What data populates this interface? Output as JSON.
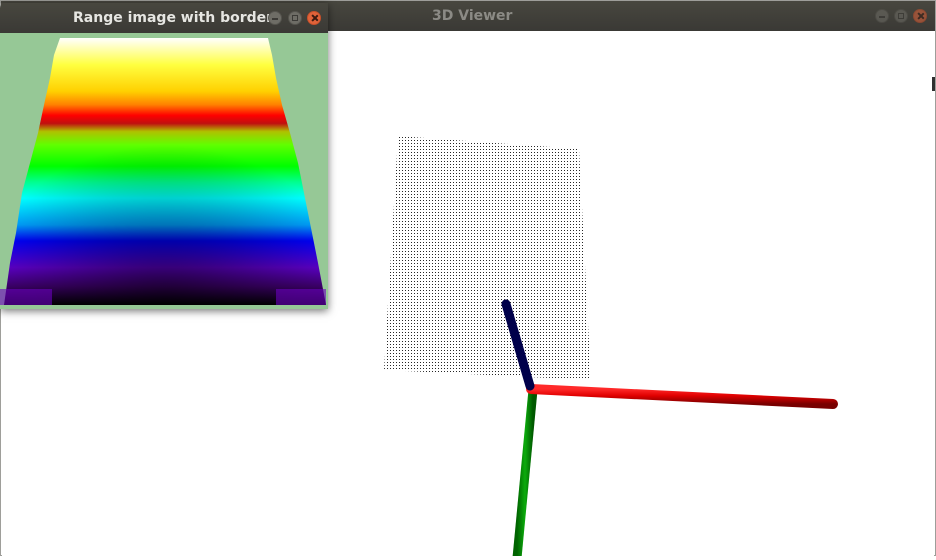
{
  "main_window": {
    "title": "3D Viewer",
    "controls": [
      "minimize-button",
      "maximize-button",
      "close-button"
    ]
  },
  "range_window": {
    "title": "Range image with borders",
    "controls": [
      "minimize-button",
      "maximize-button",
      "close-button"
    ]
  },
  "scene": {
    "background": "#ffffff",
    "point_cloud_color": "#000000",
    "axes": [
      {
        "axis": "x",
        "color": "#e00000"
      },
      {
        "axis": "y",
        "color": "#00c000"
      },
      {
        "axis": "z",
        "color": "#00004a"
      }
    ]
  },
  "range_image": {
    "background_color": "#96c896",
    "colormap": [
      "#ffffff",
      "#ffff00",
      "#ff0000",
      "#00ff00",
      "#00ffff",
      "#0000ff",
      "#8000c0",
      "#000000"
    ]
  }
}
